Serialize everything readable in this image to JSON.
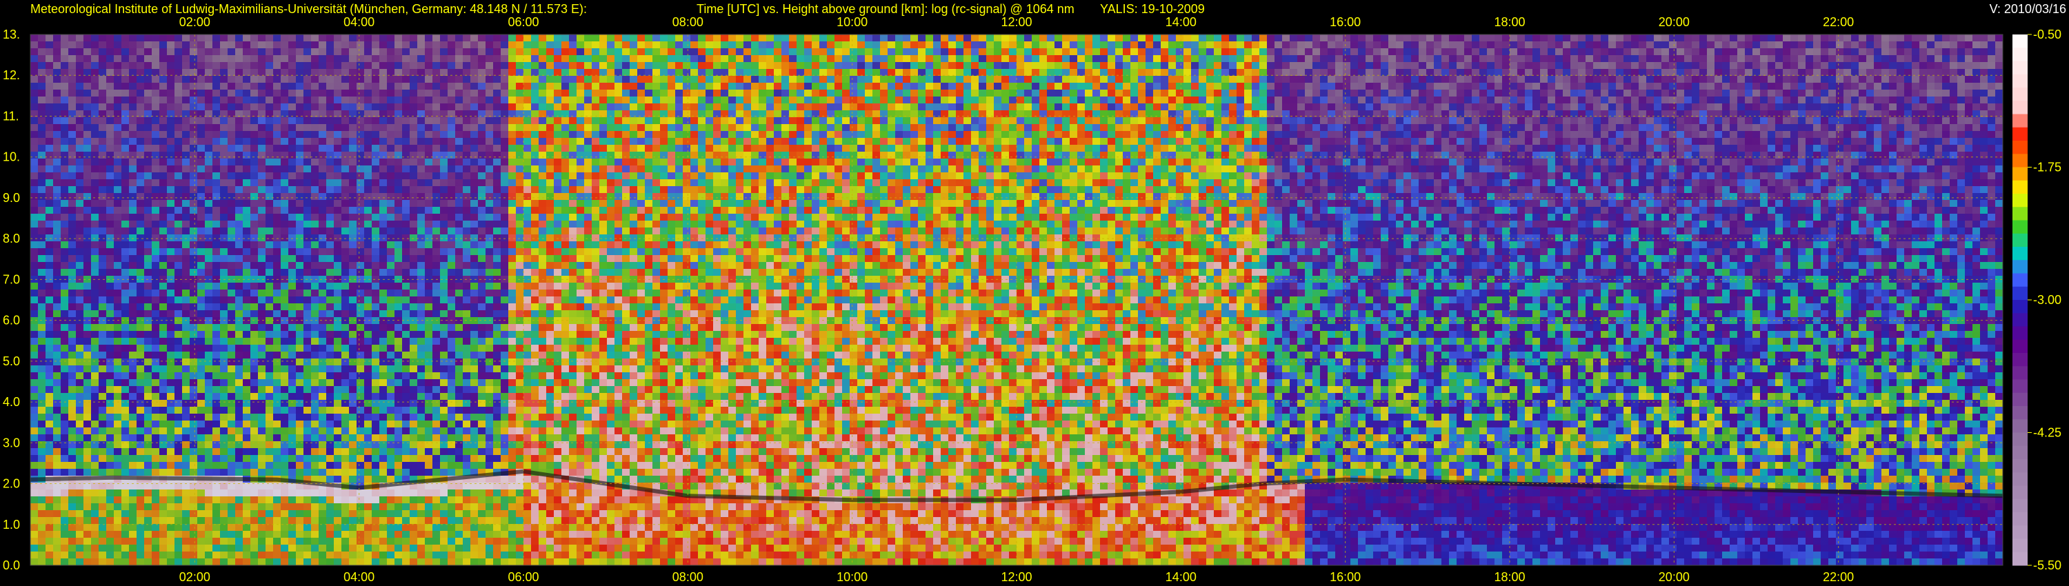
{
  "header": {
    "institute": "Meteorological Institute of Ludwig-Maximilians-Universität (München, Germany: 48.148 N / 11.573 E):",
    "plot_description": "Time [UTC] vs. Height above ground [km]: log (rc-signal) @ 1064 nm",
    "instrument_date": "YALIS: 19-10-2009",
    "version": "V: 2010/03/16"
  },
  "colors": {
    "label_yellow": "#ffff00",
    "background": "#000000",
    "grid": "#c8b400"
  },
  "chart_data": {
    "type": "heatmap",
    "title": "Time [UTC] vs. Height above ground [km]: log (rc-signal) @ 1064 nm",
    "x_ticks": [
      "02:00",
      "04:00",
      "06:00",
      "08:00",
      "10:00",
      "12:00",
      "14:00",
      "16:00",
      "18:00",
      "20:00",
      "22:00"
    ],
    "x_tick_hours": [
      2,
      4,
      6,
      8,
      10,
      12,
      14,
      16,
      18,
      20,
      22
    ],
    "xlim_hours": [
      0,
      24
    ],
    "y_ticks": [
      "0.0",
      "1.0",
      "2.0",
      "3.0",
      "4.0",
      "5.0",
      "6.0",
      "7.0",
      "8.0",
      "9.0",
      "10.",
      "11.",
      "12.",
      "13."
    ],
    "ylim_km": [
      0,
      13
    ],
    "grid": true,
    "colorbar": {
      "labels": [
        "-0.50",
        "-1.75",
        "-3.00",
        "-4.25",
        "-5.50"
      ],
      "range": [
        -5.5,
        -0.5
      ],
      "position": "right",
      "stops": [
        {
          "v": -0.5,
          "c": "#ffffff"
        },
        {
          "v": -1.2,
          "c": "#ffd0d0"
        },
        {
          "v": -1.45,
          "c": "#ff2000"
        },
        {
          "v": -1.75,
          "c": "#ff8c00"
        },
        {
          "v": -2.0,
          "c": "#ffff00"
        },
        {
          "v": -2.3,
          "c": "#40d020"
        },
        {
          "v": -2.55,
          "c": "#00d0c0"
        },
        {
          "v": -2.8,
          "c": "#4060ff"
        },
        {
          "v": -3.0,
          "c": "#2020c0"
        },
        {
          "v": -3.4,
          "c": "#600090"
        },
        {
          "v": -4.25,
          "c": "#9070a0"
        },
        {
          "v": -5.5,
          "c": "#c0a8c8"
        }
      ]
    },
    "boundary_layer_top_km": [
      {
        "t": 0.0,
        "h": 2.1
      },
      {
        "t": 1.0,
        "h": 2.15
      },
      {
        "t": 3.0,
        "h": 2.1
      },
      {
        "t": 4.0,
        "h": 1.9
      },
      {
        "t": 5.0,
        "h": 2.1
      },
      {
        "t": 6.0,
        "h": 2.3
      },
      {
        "t": 8.0,
        "h": 1.7
      },
      {
        "t": 10.0,
        "h": 1.6
      },
      {
        "t": 12.0,
        "h": 1.6
      },
      {
        "t": 13.0,
        "h": 1.7
      },
      {
        "t": 14.0,
        "h": 1.8
      },
      {
        "t": 15.0,
        "h": 2.0
      },
      {
        "t": 16.0,
        "h": 2.1
      },
      {
        "t": 18.0,
        "h": 2.0
      },
      {
        "t": 20.0,
        "h": 1.9
      },
      {
        "t": 22.0,
        "h": 1.8
      },
      {
        "t": 24.0,
        "h": 1.7
      }
    ]
  }
}
